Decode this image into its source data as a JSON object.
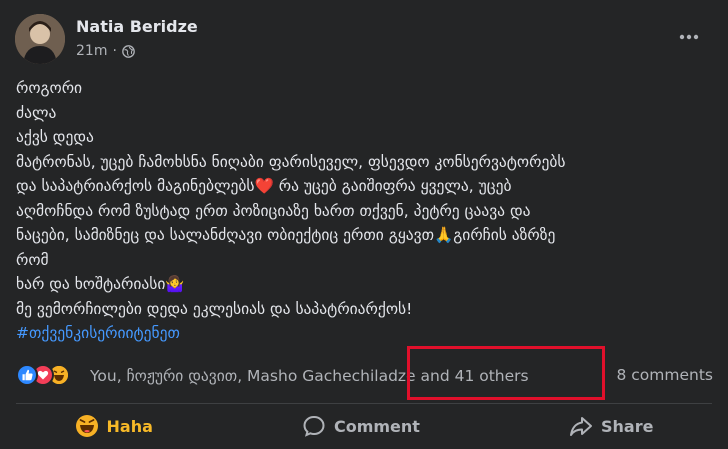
{
  "post": {
    "author": "Natia Beridze",
    "time": "21m",
    "lines": [
      "როგორი",
      "ძალა",
      "აქვს დედა",
      "მატრონას, უცებ ჩამოხსნა ნიღაბი ფარისეველ,  ფსევდო კონსერვატორებს",
      "და საპატრიარქოს მაგინებლებს",
      "აღმოჩნდა რომ ზუსტად ერთ პოზიციაზე ხართ თქვენ, პეტრე ცაავა და",
      "ნაცები,  სამიზნეც და სალანძღავი ობიექტიც ერთი გყავთ",
      "რომ",
      "ხარ და ხოშტარიასი",
      "მე ვემორჩილები დედა ეკლესიას და საპატრიარქოს!"
    ],
    "line5_rest": " რა უცებ გაიშიფრა ყველა, უცებ",
    "line7_rest": "გირჩის აზრზე",
    "emoji_heart": "❤️",
    "emoji_pray": "🙏",
    "emoji_person": "🤷‍♀️",
    "hashtag": "#თქვენკისერიიტენეთ"
  },
  "reactions": {
    "summary": "You, ჩოჟური დავით, Masho Gachechiladze and 41 others",
    "comments": "8 comments",
    "icons": [
      "like-icon",
      "love-icon",
      "haha-icon"
    ]
  },
  "actions": {
    "haha": "Haha",
    "comment": "Comment",
    "share": "Share"
  },
  "colors": {
    "background": "#242526",
    "text": "#e4e6eb",
    "muted": "#b0b3b8",
    "hashtag": "#4599ff",
    "haha_active": "#f7b928",
    "highlight_box": "#e0102b"
  }
}
